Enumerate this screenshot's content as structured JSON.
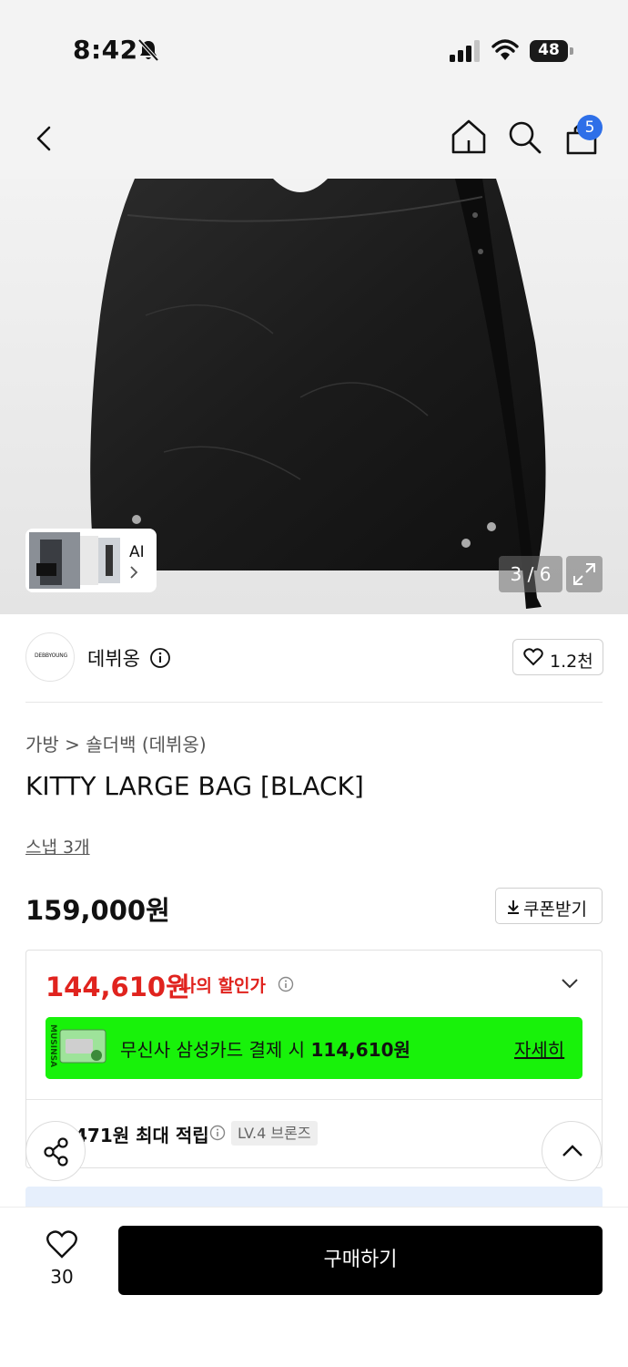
{
  "status_bar": {
    "time": "8:42",
    "battery": "48"
  },
  "header": {
    "cart_count": "5"
  },
  "gallery": {
    "ai_label": "AI",
    "counter": "3 / 6"
  },
  "brand": {
    "logo_text": "DEBBYOUNG",
    "name": "데뷔옹",
    "likes": "1.2천"
  },
  "product": {
    "breadcrumb": "가방 > 숄더백 (데뷔옹)",
    "title": "KITTY LARGE BAG [BLACK]",
    "snap": "스냅 3개",
    "price": "159,000원",
    "coupon_label": "쿠폰받기"
  },
  "discount": {
    "sale_price": "144,610원",
    "sale_label": "나의 할인가",
    "card_text_prefix": "무신사 삼성카드 결제 시 ",
    "card_price": "114,610원",
    "card_detail": "자세히",
    "card_brand_text": "MUSINSA",
    "points_text": "471원 최대 적립",
    "level": "LV.4 브론즈"
  },
  "bottom": {
    "like_count": "30",
    "buy_label": "구매하기"
  },
  "colors": {
    "sale_red": "#e0231e",
    "card_green": "#18f20a",
    "badge_blue": "#2e6fe8",
    "buy_black": "#000000"
  }
}
